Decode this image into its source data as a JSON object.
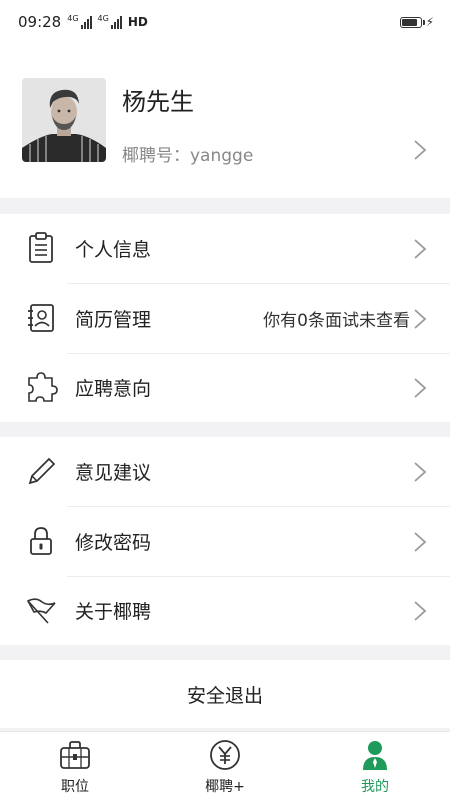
{
  "status_bar": {
    "time": "09:28",
    "net1": "4G",
    "net2": "4G",
    "hd": "HD",
    "battery_level": 0.9
  },
  "profile": {
    "name": "杨先生",
    "account_line": "椰聘号：yangge"
  },
  "menu_groups": [
    {
      "items": [
        {
          "label": "个人信息",
          "icon": "clipboard-icon"
        },
        {
          "label": "简历管理",
          "icon": "resume-profile-icon",
          "extra": "你有0条面试未查看"
        },
        {
          "label": "应聘意向",
          "icon": "puzzle-icon"
        }
      ]
    },
    {
      "items": [
        {
          "label": "意见建议",
          "icon": "pencil-icon"
        },
        {
          "label": "修改密码",
          "icon": "lock-icon"
        },
        {
          "label": "关于椰聘",
          "icon": "flag-icon"
        }
      ]
    }
  ],
  "logout": {
    "label": "安全退出"
  },
  "tabbar": {
    "tabs": [
      {
        "label": "职位",
        "icon": "briefcase-icon",
        "active": false
      },
      {
        "label": "椰聘+",
        "icon": "yuan-circle-icon",
        "active": false
      },
      {
        "label": "我的",
        "icon": "person-icon",
        "active": true
      }
    ],
    "active_color": "#1e9a5a"
  }
}
